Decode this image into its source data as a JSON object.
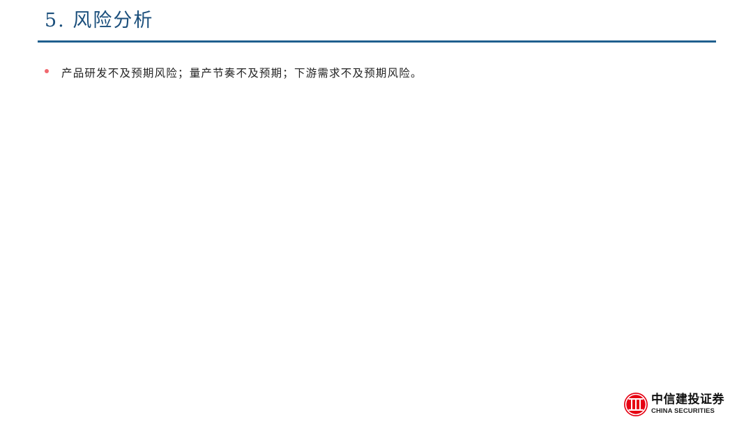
{
  "header": {
    "title": "5. 风险分析"
  },
  "content": {
    "bullets": [
      {
        "text": "产品研发不及预期风险；量产节奏不及预期；下游需求不及预期风险。"
      }
    ]
  },
  "branding": {
    "logo_icon": "citic-logo-icon",
    "name_cn": "中信建投证券",
    "name_en": "CHINA SECURITIES",
    "brand_color": "#e60012"
  },
  "colors": {
    "title": "#1b4f7c",
    "rule": "#1f5f8e",
    "bullet": "#f0686f"
  }
}
